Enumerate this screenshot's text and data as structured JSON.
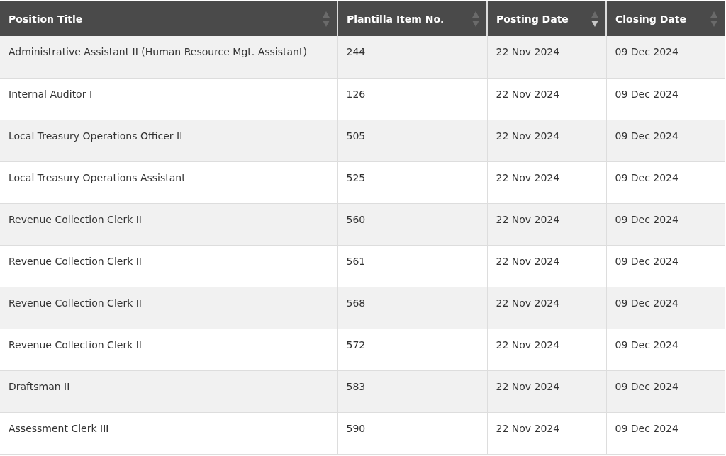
{
  "table": {
    "columns": [
      {
        "label": "Position Title",
        "sorted_descending": false
      },
      {
        "label": "Plantilla Item No.",
        "sorted_descending": false
      },
      {
        "label": "Posting Date",
        "sorted_descending": true
      },
      {
        "label": "Closing Date",
        "sorted_descending": false
      }
    ],
    "rows": [
      [
        "Administrative Assistant II (Human Resource Mgt. Assistant)",
        "244",
        "22 Nov 2024",
        "09 Dec 2024"
      ],
      [
        "Internal Auditor I",
        "126",
        "22 Nov 2024",
        "09 Dec 2024"
      ],
      [
        "Local Treasury Operations Officer II",
        "505",
        "22 Nov 2024",
        "09 Dec 2024"
      ],
      [
        "Local Treasury Operations Assistant",
        "525",
        "22 Nov 2024",
        "09 Dec 2024"
      ],
      [
        "Revenue Collection Clerk II",
        "560",
        "22 Nov 2024",
        "09 Dec 2024"
      ],
      [
        "Revenue Collection Clerk II",
        "561",
        "22 Nov 2024",
        "09 Dec 2024"
      ],
      [
        "Revenue Collection Clerk II",
        "568",
        "22 Nov 2024",
        "09 Dec 2024"
      ],
      [
        "Revenue Collection Clerk II",
        "572",
        "22 Nov 2024",
        "09 Dec 2024"
      ],
      [
        "Draftsman II",
        "583",
        "22 Nov 2024",
        "09 Dec 2024"
      ],
      [
        "Assessment Clerk III",
        "590",
        "22 Nov 2024",
        "09 Dec 2024"
      ]
    ]
  }
}
